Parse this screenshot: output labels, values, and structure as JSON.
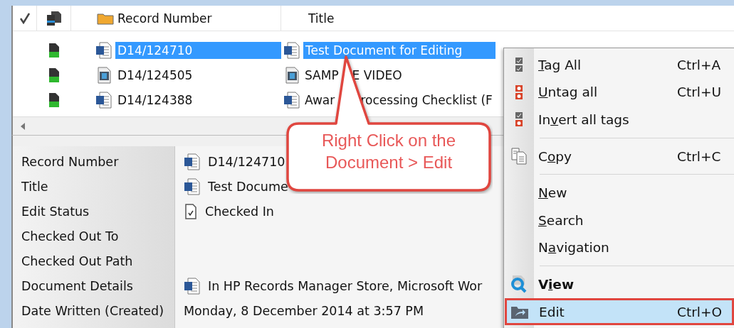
{
  "list": {
    "columns": [
      {
        "kind": "tag"
      },
      {
        "kind": "status"
      },
      {
        "kind": "record",
        "label": "Record Number"
      },
      {
        "kind": "title",
        "label": "Title"
      }
    ],
    "rows": [
      {
        "kind": "word",
        "record_number": "D14/124710",
        "title_parts": [
          "Test Document for Editing"
        ],
        "selected": true
      },
      {
        "kind": "video",
        "record_number": "D14/124505",
        "title_parts": [
          "SAMP",
          "E VIDEO"
        ],
        "selected": false
      },
      {
        "kind": "word",
        "record_number": "D14/124388",
        "title_parts": [
          "Awar",
          "rocessing Checklist (F"
        ],
        "selected": false
      }
    ]
  },
  "details": [
    {
      "kind": "document",
      "label": "Record Number",
      "value": "D14/124710"
    },
    {
      "kind": "document",
      "label": "Title",
      "value": "Test Docume"
    },
    {
      "kind": "status",
      "label": "Edit Status",
      "value": "Checked In"
    },
    {
      "label": "Checked Out To"
    },
    {
      "label": "Checked Out Path"
    },
    {
      "kind": "document",
      "label": "Document Details",
      "value": "In HP Records Manager Store, Microsoft Wor"
    },
    {
      "kind": "text",
      "label": "Date Written (Created)",
      "value": "Monday, 8 December 2014 at 3:57 PM"
    }
  ],
  "context_menu": [
    {
      "kind": "item",
      "key": "T",
      "post": "ag All",
      "shortcut": "Ctrl+A",
      "default": false,
      "selected": false
    },
    {
      "kind": "item",
      "key": "U",
      "post": "ntag all",
      "shortcut": "Ctrl+U",
      "default": false,
      "selected": false
    },
    {
      "kind": "item",
      "pre": "In",
      "key": "v",
      "post": "ert all tags",
      "default": false,
      "selected": false
    },
    {
      "kind": "separator"
    },
    {
      "kind": "item",
      "pre": "C",
      "key": "o",
      "post": "py",
      "shortcut": "Ctrl+C",
      "default": false,
      "selected": false
    },
    {
      "kind": "separator"
    },
    {
      "kind": "item",
      "key": "N",
      "post": "ew",
      "default": false,
      "selected": false
    },
    {
      "kind": "item",
      "key": "S",
      "post": "earch",
      "default": false,
      "selected": false
    },
    {
      "kind": "item",
      "pre": "N",
      "key": "a",
      "post": "vigation",
      "default": false,
      "selected": false
    },
    {
      "kind": "separator"
    },
    {
      "kind": "item",
      "pre": "V",
      "key": "i",
      "post": "ew",
      "default": true,
      "selected": false
    },
    {
      "kind": "item",
      "pre": "Edit",
      "shortcut": "Ctrl+O",
      "default": false,
      "selected": true
    }
  ],
  "callout": {
    "lines": [
      "Right Click on the",
      "Document > Edit"
    ]
  }
}
